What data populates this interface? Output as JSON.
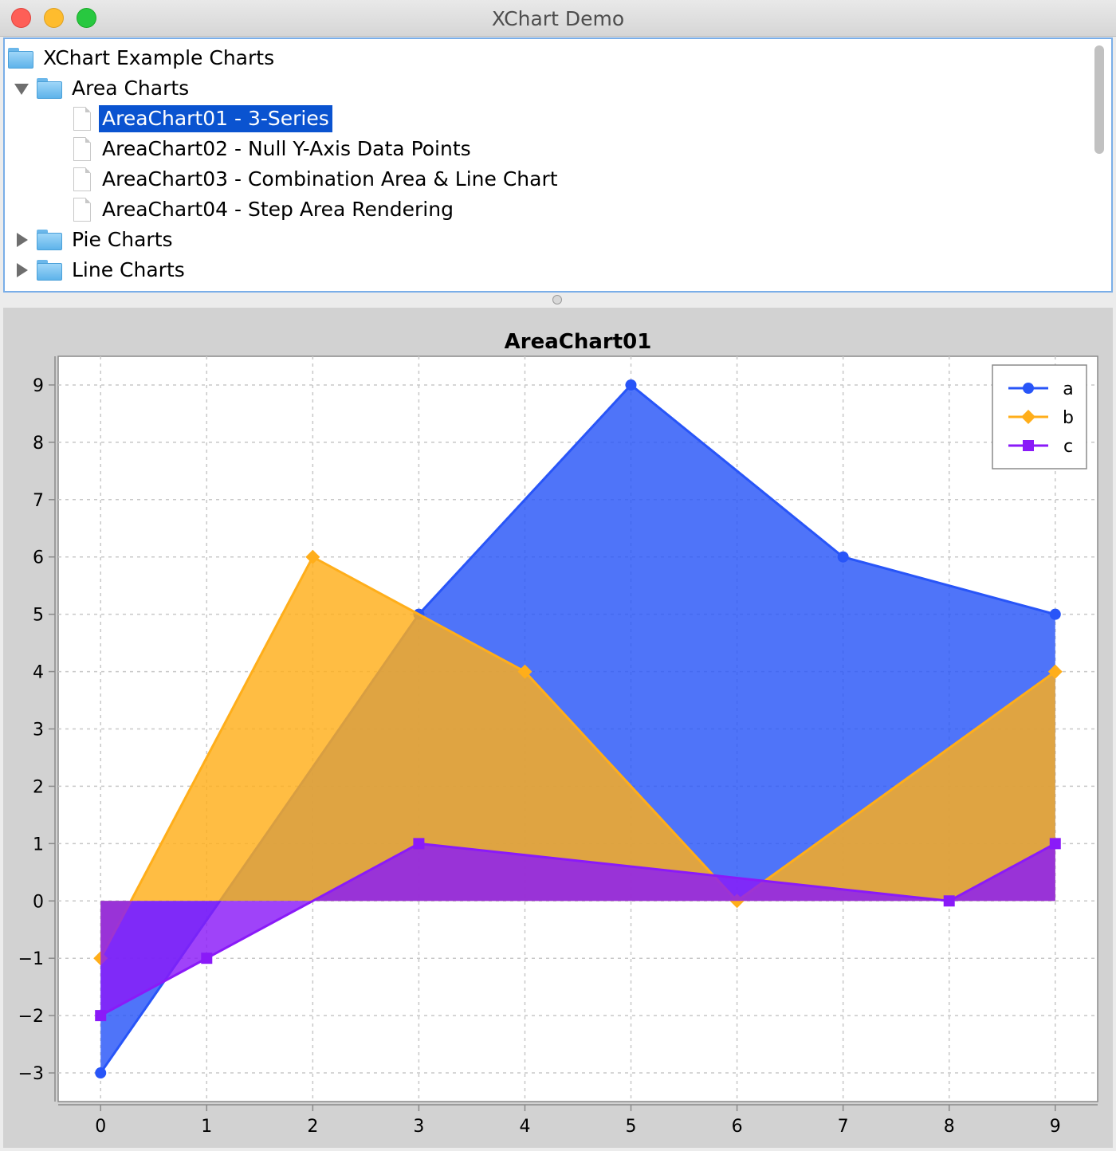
{
  "window": {
    "title": "XChart Demo"
  },
  "tree": {
    "root_label": "XChart Example Charts",
    "folders": [
      {
        "label": "Area Charts",
        "expanded": true,
        "children": [
          "AreaChart01 - 3-Series",
          "AreaChart02 - Null Y-Axis Data Points",
          "AreaChart03 - Combination Area & Line Chart",
          "AreaChart04 - Step Area Rendering"
        ],
        "selected_child": "AreaChart01 - 3-Series"
      },
      {
        "label": "Pie Charts",
        "expanded": false
      },
      {
        "label": "Line Charts",
        "expanded": false
      }
    ]
  },
  "chart_data": {
    "type": "area",
    "title": "AreaChart01",
    "xlabel": "",
    "ylabel": "",
    "x": [
      0,
      1,
      2,
      3,
      4,
      5,
      6,
      7,
      8,
      9
    ],
    "xlim": [
      -0.4,
      9.4
    ],
    "ylim": [
      -3.5,
      9.5
    ],
    "x_ticks": [
      0,
      1,
      2,
      3,
      4,
      5,
      6,
      7,
      8,
      9
    ],
    "y_ticks": [
      -3,
      -2,
      -1,
      0,
      1,
      2,
      3,
      4,
      5,
      6,
      7,
      8,
      9
    ],
    "grid": true,
    "legend_position": "top-right",
    "series": [
      {
        "name": "a",
        "color": "#2855f8",
        "marker": "circle",
        "x": [
          0,
          3,
          5,
          7,
          9
        ],
        "values": [
          -3,
          5,
          9,
          6,
          5
        ]
      },
      {
        "name": "b",
        "color": "#ffae1a",
        "marker": "diamond",
        "x": [
          0,
          2,
          4,
          6,
          9
        ],
        "values": [
          -1,
          6,
          4,
          0,
          4
        ]
      },
      {
        "name": "c",
        "color": "#8a1af8",
        "marker": "square",
        "x": [
          0,
          1,
          3,
          8,
          9
        ],
        "values": [
          -2,
          -1,
          1,
          0,
          1
        ]
      }
    ]
  }
}
